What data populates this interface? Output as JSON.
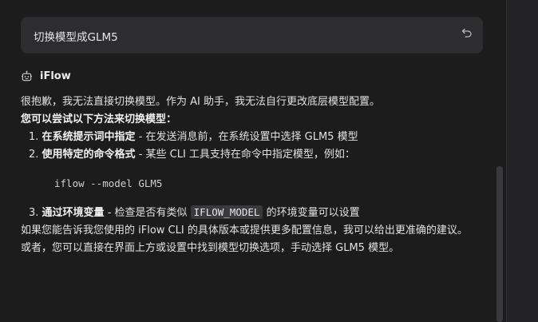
{
  "user_message": {
    "text": "切换模型成GLM5",
    "undo_icon": "undo-icon"
  },
  "assistant": {
    "name": "iFlow",
    "icon": "bot-icon",
    "intro": "很抱歉，我无法直接切换模型。作为 AI 助手，我无法自行更改底层模型配置。",
    "try_heading": "您可以尝试以下方法来切换模型：",
    "items": [
      {
        "number": "1.",
        "title": "在系统提示词中指定",
        "text": " - 在发送消息前，在系统设置中选择 GLM5 模型"
      },
      {
        "number": "2.",
        "title": "使用特定的命令格式",
        "text": " - 某些 CLI 工具支持在命令中指定模型，例如："
      },
      {
        "number": "3.",
        "title": "通过环境变量",
        "text_before": " - 检查是否有类似 ",
        "code": "IFLOW_MODEL",
        "text_after": " 的环境变量可以设置"
      }
    ],
    "code_example": "iflow --model GLM5",
    "followup": "如果您能告诉我您使用的 iFlow CLI 的具体版本或提供更多配置信息，我可以给出更准确的建议。",
    "alternative": "或者，您可以直接在界面上方或设置中找到模型切换选项，手动选择 GLM5 模型。"
  }
}
